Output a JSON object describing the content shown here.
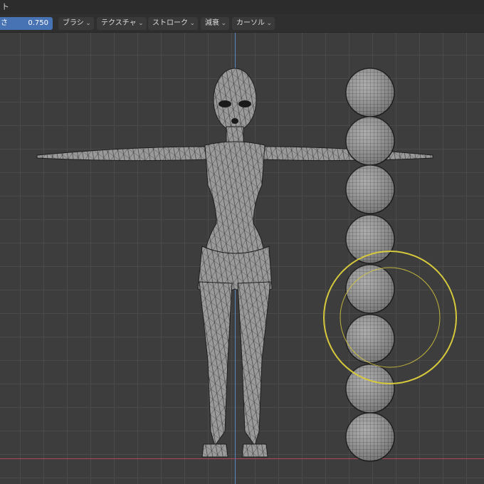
{
  "header": {
    "title_fragment": "ト"
  },
  "toolbar": {
    "strength": {
      "label": "さ",
      "value": "0.750"
    },
    "menus": [
      {
        "label": "ブラシ"
      },
      {
        "label": "テクスチャ"
      },
      {
        "label": "ストローク"
      },
      {
        "label": "減衰"
      },
      {
        "label": "カーソル"
      }
    ],
    "dropdown_icon": "chevron-down-icon"
  },
  "viewport": {
    "background": "#3d3d3d",
    "grid_color": "#4a4a4a",
    "z_axis_color": "#5b86bf",
    "x_axis_color": "#a8475d",
    "brush_cursor_color": "#d7c93c",
    "mesh_fill": "#9a9a9a",
    "wire_color": "#1e1e1e",
    "sphere_count": 8
  }
}
